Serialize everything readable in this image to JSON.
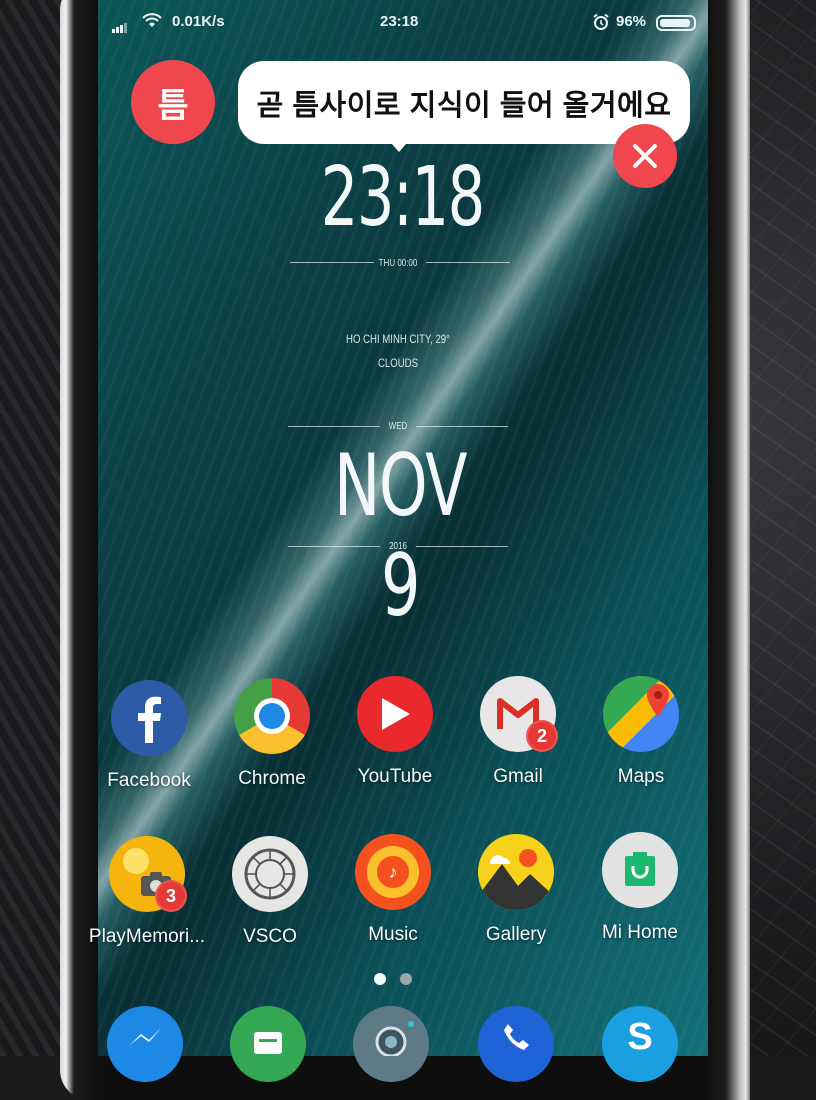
{
  "status_bar": {
    "network_speed": "0.01K/s",
    "time": "23:18",
    "battery": "96%"
  },
  "overlay": {
    "badge_label": "틈",
    "message": "곧 틈사이로 지식이 들어 올거에요"
  },
  "widget": {
    "clock": "23:18",
    "clock_sub": "THU 00:00",
    "location": "HO CHI MINH CITY, 29°",
    "condition": "CLOUDS",
    "weekday": "WED",
    "date": "NOV 9",
    "year": "2016"
  },
  "apps": [
    {
      "label": "Facebook",
      "icon": "facebook-icon"
    },
    {
      "label": "Chrome",
      "icon": "chrome-icon"
    },
    {
      "label": "YouTube",
      "icon": "youtube-icon"
    },
    {
      "label": "Gmail",
      "icon": "gmail-icon",
      "badge": "2"
    },
    {
      "label": "Maps",
      "icon": "maps-icon"
    },
    {
      "label": "PlayMemori...",
      "icon": "playmemories-icon",
      "badge": "3"
    },
    {
      "label": "VSCO",
      "icon": "vsco-icon"
    },
    {
      "label": "Music",
      "icon": "music-icon"
    },
    {
      "label": "Gallery",
      "icon": "gallery-icon"
    },
    {
      "label": "Mi Home",
      "icon": "mihome-icon"
    }
  ],
  "dock": [
    {
      "icon": "messenger-icon"
    },
    {
      "icon": "messages-icon"
    },
    {
      "icon": "camera-icon"
    },
    {
      "icon": "phone-icon"
    },
    {
      "icon": "skype-icon"
    }
  ],
  "colors": {
    "accent_red": "#f0474f",
    "badge_red": "#e53935"
  }
}
